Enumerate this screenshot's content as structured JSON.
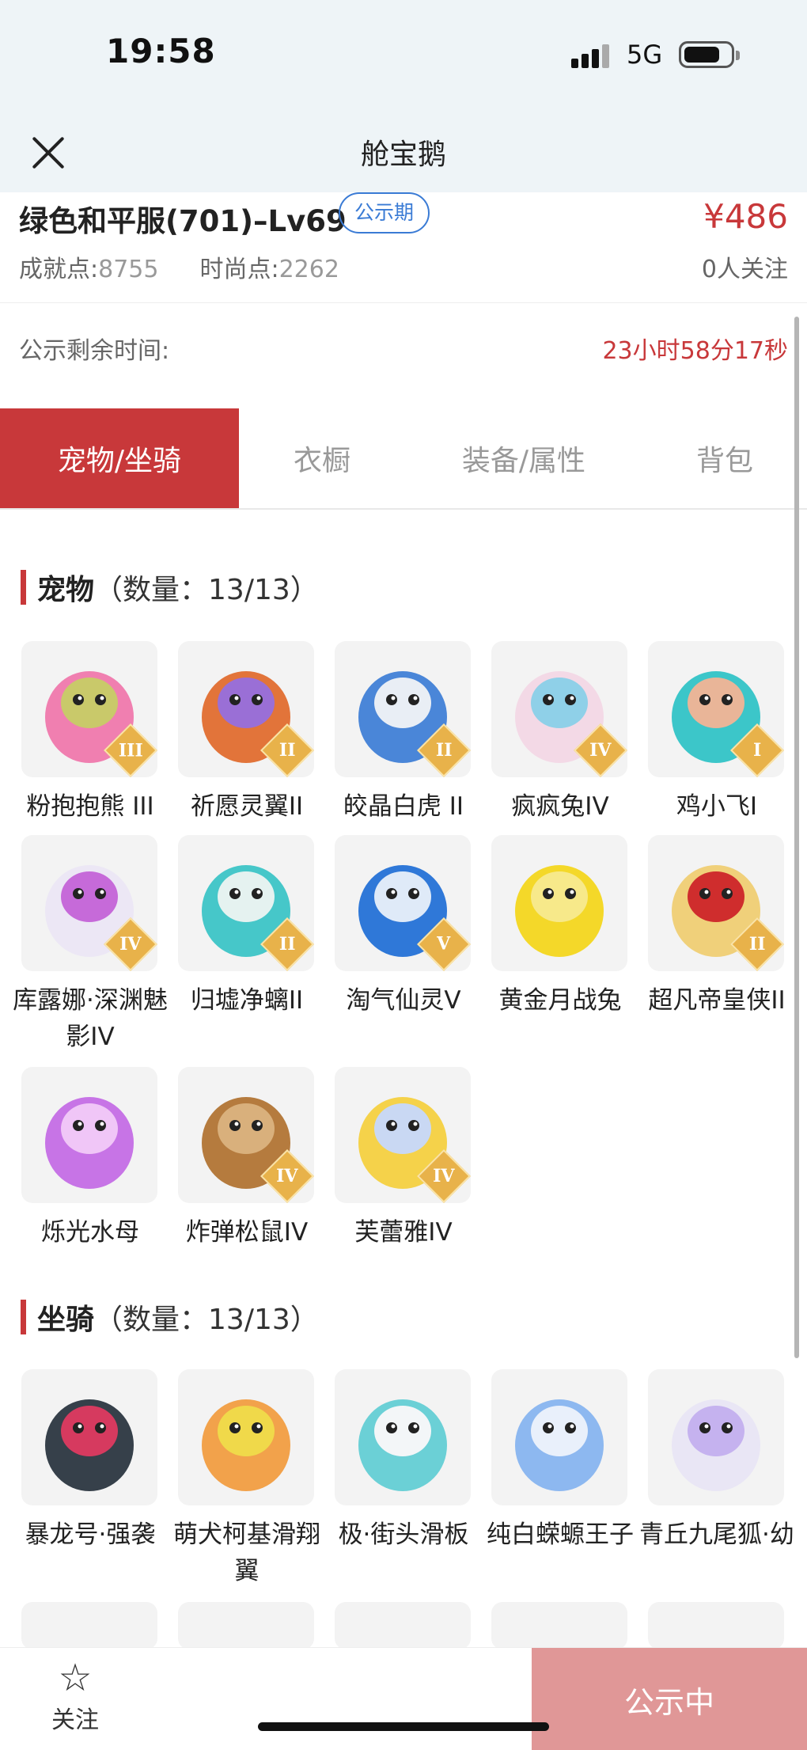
{
  "status_bar": {
    "time": "19:58",
    "network": "5G"
  },
  "nav": {
    "title": "舱宝鹅"
  },
  "item": {
    "title": "绿色和平服(701)–Lv69",
    "badge": "公示期",
    "price": "¥486",
    "achievement_label": "成就点:",
    "achievement_value": "8755",
    "fashion_label": "时尚点:",
    "fashion_value": "2262",
    "followers": "0人关注"
  },
  "countdown": {
    "label": "公示剩余时间:",
    "value": "23小时58分17秒"
  },
  "tabs": [
    {
      "label": "宠物/坐骑",
      "active": true
    },
    {
      "label": "衣橱",
      "active": false
    },
    {
      "label": "装备/属性",
      "active": false
    },
    {
      "label": "背包",
      "active": false
    }
  ],
  "pets": {
    "name": "宠物",
    "count": "（数量：13/13）",
    "items": [
      {
        "label": "粉抱抱熊 III",
        "grade": "III",
        "icon": "pink-bear-icon"
      },
      {
        "label": "祈愿灵翼II",
        "grade": "II",
        "icon": "eagle-icon"
      },
      {
        "label": "皎晶白虎 II",
        "grade": "II",
        "icon": "white-tiger-icon"
      },
      {
        "label": "疯疯兔IV",
        "grade": "IV",
        "icon": "rabbit-icon"
      },
      {
        "label": "鸡小飞I",
        "grade": "I",
        "icon": "chick-muscle-icon"
      },
      {
        "label": "库露娜·深渊魅影IV",
        "grade": "IV",
        "icon": "white-haired-girl-icon"
      },
      {
        "label": "归墟净螭II",
        "grade": "II",
        "icon": "teal-dragon-icon"
      },
      {
        "label": "淘气仙灵V",
        "grade": "V",
        "icon": "blue-puppy-icon"
      },
      {
        "label": "黄金月战兔",
        "grade": "",
        "icon": "golden-rabbit-icon"
      },
      {
        "label": "超凡帝皇侠II",
        "grade": "II",
        "icon": "armored-hero-icon"
      },
      {
        "label": "烁光水母",
        "grade": "",
        "icon": "jellyfish-icon"
      },
      {
        "label": "炸弹松鼠IV",
        "grade": "IV",
        "icon": "squirrel-icon"
      },
      {
        "label": "芙蕾雅IV",
        "grade": "IV",
        "icon": "valkyrie-girl-icon"
      }
    ]
  },
  "mounts": {
    "name": "坐骑",
    "count": "（数量：13/13）",
    "items": [
      {
        "label": "暴龙号·强袭",
        "grade": "",
        "icon": "mech-dinosaur-icon"
      },
      {
        "label": "萌犬柯基滑翔翼",
        "grade": "",
        "icon": "corgi-glider-icon"
      },
      {
        "label": "极·街头滑板",
        "grade": "",
        "icon": "skateboard-icon"
      },
      {
        "label": "纯白蝾螈王子",
        "grade": "",
        "icon": "white-axolotl-icon"
      },
      {
        "label": "青丘九尾狐·幼",
        "grade": "",
        "icon": "nine-tail-fox-icon"
      }
    ]
  },
  "bottom": {
    "follow_label": "关注",
    "status_label": "公示中"
  },
  "colors": {
    "accent": "#c8383a",
    "badge": "#3a7bd5",
    "status_button": "#e09797"
  }
}
